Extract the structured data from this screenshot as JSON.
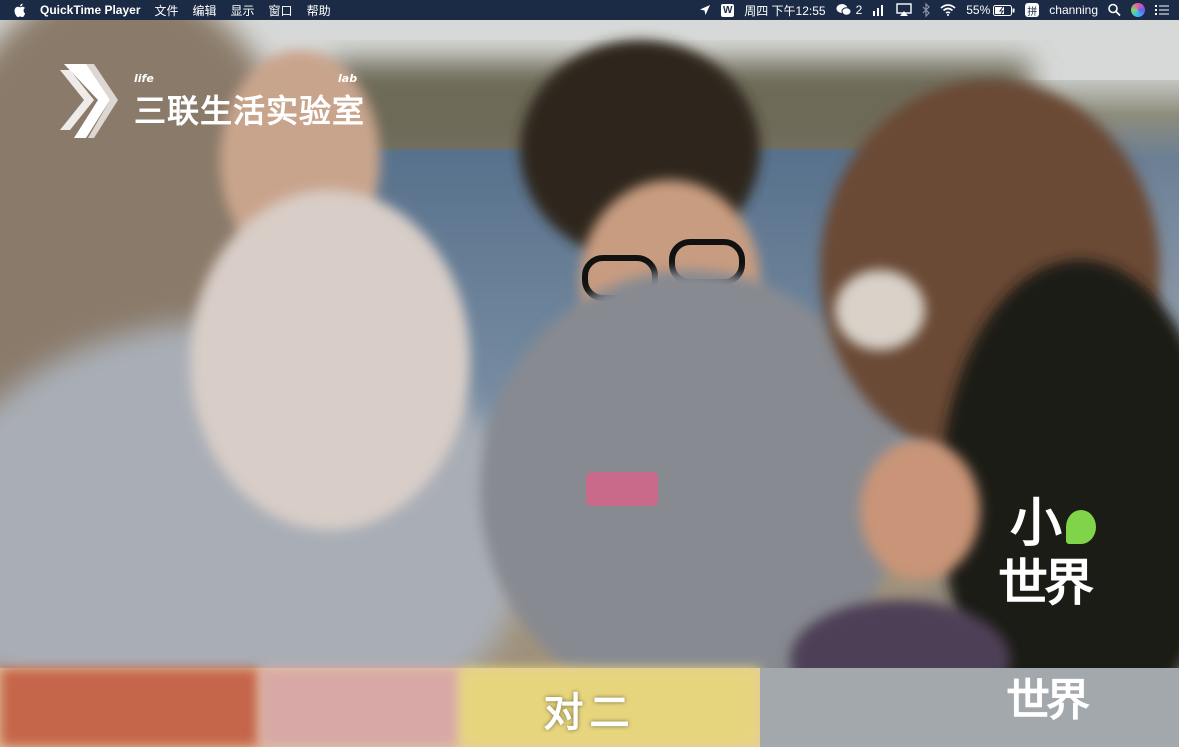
{
  "menubar": {
    "app_name": "QuickTime Player",
    "menus": [
      "文件",
      "编辑",
      "显示",
      "窗口",
      "帮助"
    ],
    "datetime": "周四 下午12:55",
    "wechat_count": "2",
    "battery": "55%",
    "input_method": "拼",
    "user": "channing",
    "w_badge": "W"
  },
  "video": {
    "logo_en_left": "life",
    "logo_en_right": "lab",
    "logo_cn": "三联生活实验室",
    "watermark_line1": "小",
    "watermark_line2": "世界",
    "subtitle": "对二",
    "watermark_echo": "世界"
  },
  "colors": {
    "menubar_bg": "#1b2a45",
    "watermark_accent": "#7fd44a"
  }
}
